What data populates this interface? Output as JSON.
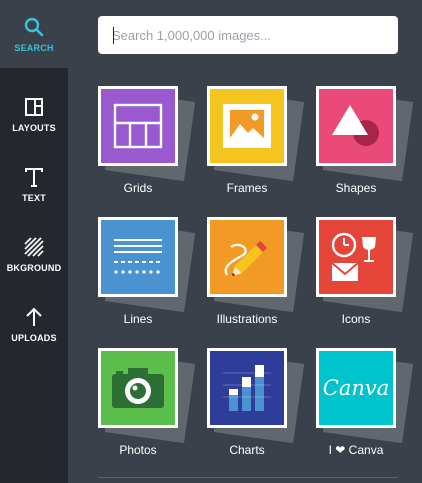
{
  "sidebar": {
    "items": [
      {
        "label": "SEARCH",
        "icon": "search-icon",
        "active": true
      },
      {
        "label": "LAYOUTS",
        "icon": "layouts-icon"
      },
      {
        "label": "TEXT",
        "icon": "text-icon"
      },
      {
        "label": "BKGROUND",
        "icon": "background-icon"
      },
      {
        "label": "UPLOADS",
        "icon": "upload-arrow-icon"
      }
    ]
  },
  "search": {
    "placeholder": "Search 1,000,000 images...",
    "value": ""
  },
  "tiles": [
    {
      "label": "Grids",
      "color": "#9b59d0",
      "icon": "grid-icon"
    },
    {
      "label": "Frames",
      "color": "#f4c51f",
      "icon": "frame-icon"
    },
    {
      "label": "Shapes",
      "color": "#e94a7a",
      "icon": "shapes-icon"
    },
    {
      "label": "Lines",
      "color": "#4a92d0",
      "icon": "lines-icon"
    },
    {
      "label": "Illustrations",
      "color": "#f39a26",
      "icon": "pencil-icon"
    },
    {
      "label": "Icons",
      "color": "#e6453a",
      "icon": "icons-icon"
    },
    {
      "label": "Photos",
      "color": "#5cbf4b",
      "icon": "camera-icon"
    },
    {
      "label": "Charts",
      "color": "#2e3d9a",
      "icon": "bar-chart-icon"
    },
    {
      "label": "I ❤ Canva",
      "color": "#00c4cc",
      "icon": "canva-logo",
      "logo_text": "Canva"
    }
  ],
  "colors": {
    "accent": "#33c5d9",
    "sidebar": "#24282e",
    "panel": "#3b414b"
  }
}
